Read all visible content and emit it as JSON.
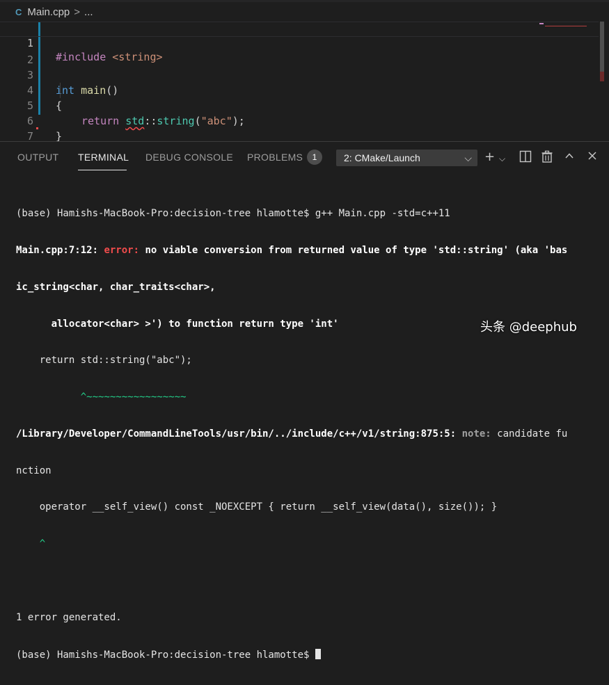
{
  "breadcrumb": {
    "icon": "C",
    "file": "Main.cpp",
    "separator": ">",
    "more": "..."
  },
  "editor": {
    "line_numbers": [
      "1",
      "2",
      "3",
      "4",
      "5",
      "6",
      "7"
    ],
    "line1": {
      "directive": "#include",
      "header": " <string>"
    },
    "line3": {
      "type": "int",
      "name": " main",
      "parens": "()"
    },
    "line4": {
      "text": "{"
    },
    "line5": {
      "kw": "return",
      "ns": "std",
      "sep": "::",
      "fn": "string",
      "open": "(",
      "arg": "\"abc\"",
      "close": ");"
    },
    "line6": {
      "text": "}"
    }
  },
  "panel": {
    "tabs": [
      "OUTPUT",
      "TERMINAL",
      "DEBUG CONSOLE",
      "PROBLEMS"
    ],
    "problems_count": "1",
    "terminal_select": "2: CMake/Launch",
    "icons": [
      "add-terminal-icon",
      "chevron-down-icon",
      "split-terminal-icon",
      "trash-icon",
      "chevron-up-icon",
      "close-icon"
    ]
  },
  "terminal": {
    "l1": "(base) Hamishs-MacBook-Pro:decision-tree hlamotte$ g++ Main.cpp -std=c++11",
    "l2_loc": "Main.cpp:7:12: ",
    "l2_err": "error:",
    "l2_msg": " no viable conversion from returned value of type 'std::string' (aka 'bas",
    "l3": "ic_string<char, char_traits<char>,",
    "l4": "      allocator<char> >') to function return type 'int'",
    "l5": "    return std::string(\"abc\");",
    "l6": "           ^~~~~~~~~~~~~~~~~~",
    "l7_loc": "/Library/Developer/CommandLineTools/usr/bin/../include/c++/v1/string:875:5: ",
    "l7_note": "note:",
    "l7_msg": " candidate fu",
    "l8": "nction",
    "l9": "    operator __self_view() const _NOEXCEPT { return __self_view(data(), size()); }",
    "l10": "    ^",
    "l11": "",
    "l12": "1 error generated.",
    "l13": "(base) Hamishs-MacBook-Pro:decision-tree hlamotte$ "
  },
  "watermark": "头条 @deephub"
}
